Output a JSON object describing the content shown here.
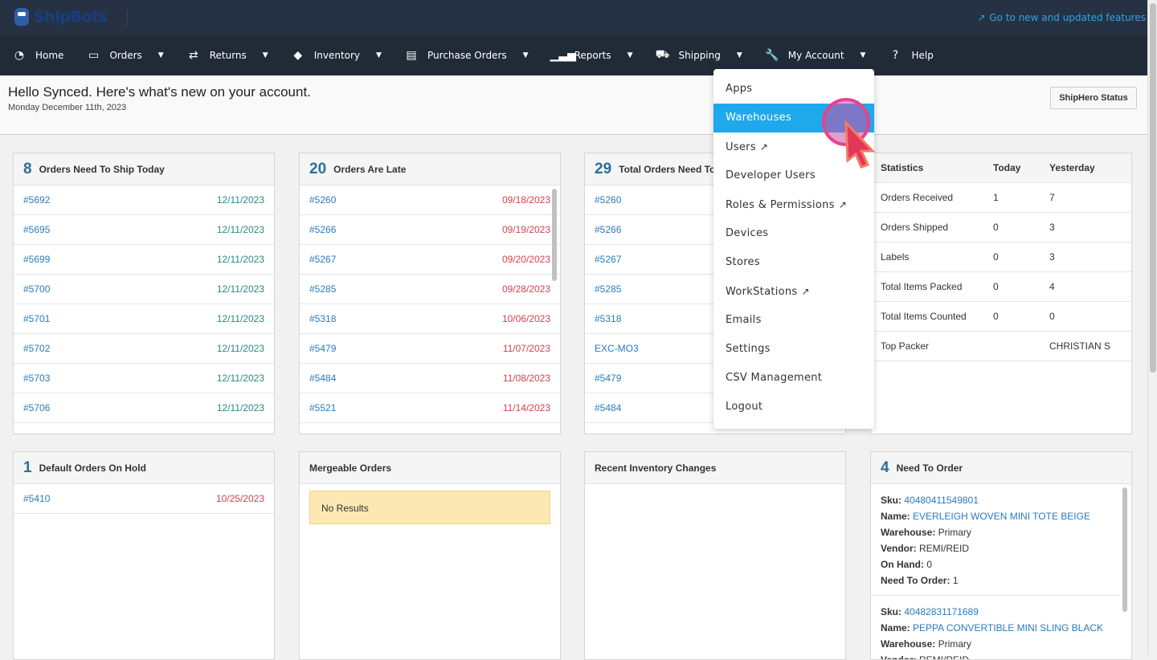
{
  "header": {
    "logo": "ShipBots",
    "new_features": "Go to new and updated features"
  },
  "nav": [
    {
      "label": "Home",
      "icon": "dashboard-icon",
      "glyph": "◔",
      "caret": false
    },
    {
      "label": "Orders",
      "icon": "inbox-icon",
      "glyph": "▭",
      "caret": true
    },
    {
      "label": "Returns",
      "icon": "exchange-icon",
      "glyph": "⇄",
      "caret": true
    },
    {
      "label": "Inventory",
      "icon": "tags-icon",
      "glyph": "◆",
      "caret": true
    },
    {
      "label": "Purchase Orders",
      "icon": "archive-icon",
      "glyph": "▤",
      "caret": true
    },
    {
      "label": "Reports",
      "icon": "signal-icon",
      "glyph": "▁▃▅",
      "caret": true
    },
    {
      "label": "Shipping",
      "icon": "truck-icon",
      "glyph": "⛟",
      "caret": true
    },
    {
      "label": "My Account",
      "icon": "wrench-icon",
      "glyph": "🔧",
      "caret": true
    },
    {
      "label": "Help",
      "icon": "question-circle-icon",
      "glyph": "?",
      "caret": false
    }
  ],
  "greeting": {
    "title": "Hello Synced. Here's what's new on your account.",
    "date": "Monday December 11th, 2023",
    "status_button": "ShipHero Status"
  },
  "panels": {
    "ship_today": {
      "count": "8",
      "title": "Orders Need To Ship Today",
      "rows": [
        [
          "#5692",
          "12/11/2023"
        ],
        [
          "#5695",
          "12/11/2023"
        ],
        [
          "#5699",
          "12/11/2023"
        ],
        [
          "#5700",
          "12/11/2023"
        ],
        [
          "#5701",
          "12/11/2023"
        ],
        [
          "#5702",
          "12/11/2023"
        ],
        [
          "#5703",
          "12/11/2023"
        ],
        [
          "#5706",
          "12/11/2023"
        ]
      ]
    },
    "late": {
      "count": "20",
      "title": "Orders Are Late",
      "rows": [
        [
          "#5260",
          "09/18/2023"
        ],
        [
          "#5266",
          "09/19/2023"
        ],
        [
          "#5267",
          "09/20/2023"
        ],
        [
          "#5285",
          "09/28/2023"
        ],
        [
          "#5318",
          "10/06/2023"
        ],
        [
          "#5479",
          "11/07/2023"
        ],
        [
          "#5484",
          "11/08/2023"
        ],
        [
          "#5521",
          "11/14/2023"
        ]
      ]
    },
    "total": {
      "count": "29",
      "title": "Total Orders Need To Ship",
      "rows": [
        [
          "#5260",
          ""
        ],
        [
          "#5266",
          ""
        ],
        [
          "#5267",
          ""
        ],
        [
          "#5285",
          ""
        ],
        [
          "#5318",
          ""
        ],
        [
          "EXC-MO3",
          ""
        ],
        [
          "#5479",
          ""
        ],
        [
          "#5484",
          ""
        ]
      ]
    },
    "stats": {
      "headers": [
        "Statistics",
        "Today",
        "Yesterday"
      ],
      "rows": [
        [
          "Orders Received",
          "1",
          "7"
        ],
        [
          "Orders Shipped",
          "0",
          "3"
        ],
        [
          "Labels",
          "0",
          "3"
        ],
        [
          "Total Items Packed",
          "0",
          "4"
        ],
        [
          "Total Items Counted",
          "0",
          "0"
        ],
        [
          "Top Packer",
          "",
          "CHRISTIAN S"
        ]
      ]
    },
    "on_hold": {
      "count": "1",
      "title": "Default Orders On Hold",
      "rows": [
        [
          "#5410",
          "10/25/2023"
        ]
      ]
    },
    "mergeable": {
      "title": "Mergeable Orders",
      "empty": "No Results"
    },
    "inventory_changes": {
      "title": "Recent Inventory Changes"
    },
    "need_to_order": {
      "count": "4",
      "title": "Need To Order",
      "labels": {
        "sku": "Sku:",
        "name": "Name:",
        "warehouse": "Warehouse:",
        "vendor": "Vendor:",
        "on_hand": "On Hand:",
        "need": "Need To Order:"
      },
      "items": [
        {
          "sku": "40480411549801",
          "name": "EVERLEIGH WOVEN MINI TOTE BEIGE",
          "warehouse": "Primary",
          "vendor": "REMI/REID",
          "on_hand": "0",
          "need": "1"
        },
        {
          "sku": "40482831171689",
          "name": "PEPPA CONVERTIBLE MINI SLING BLACK",
          "warehouse": "Primary",
          "vendor": "REMI/REID"
        }
      ]
    }
  },
  "account_menu": {
    "active": "Warehouses",
    "items": [
      {
        "label": "Apps",
        "external": false
      },
      {
        "label": "Warehouses",
        "external": false
      },
      {
        "label": "Users",
        "external": true
      },
      {
        "label": "Developer Users",
        "external": false
      },
      {
        "label": "Roles & Permissions",
        "external": true
      },
      {
        "label": "Devices",
        "external": false
      },
      {
        "label": "Stores",
        "external": false
      },
      {
        "label": "WorkStations",
        "external": true
      },
      {
        "label": "Emails",
        "external": false
      },
      {
        "label": "Settings",
        "external": false
      },
      {
        "label": "CSV Management",
        "external": false
      },
      {
        "label": "Logout",
        "external": false
      }
    ]
  },
  "colors": {
    "accent": "#1fa8ec",
    "link": "#2a7bbf",
    "late": "#d0434e",
    "today": "#2a8a80",
    "nav_bg": "#212a37"
  }
}
